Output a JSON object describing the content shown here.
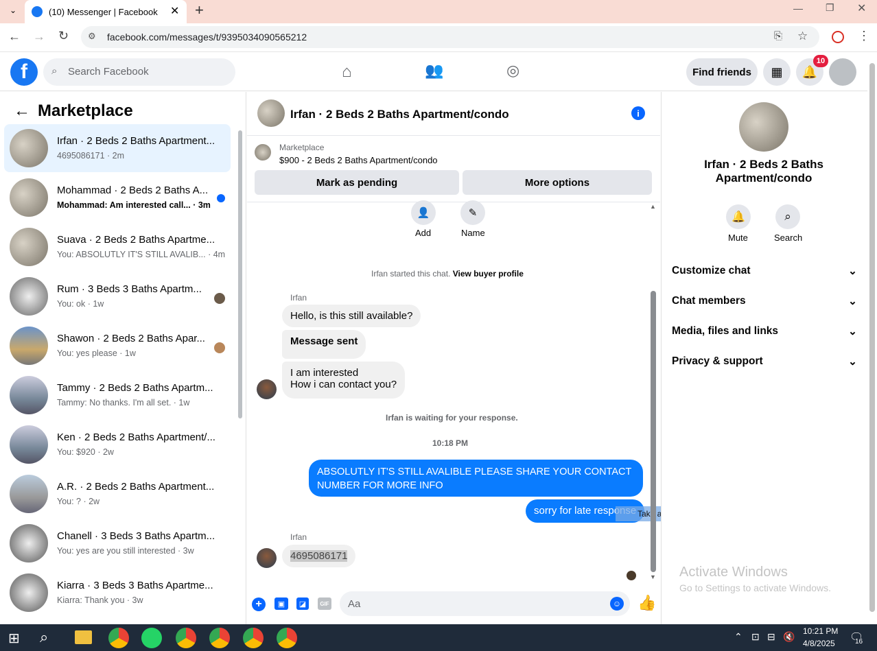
{
  "browser": {
    "tab_title": "(10) Messenger | Facebook",
    "url": "facebook.com/messages/t/9395034090565212"
  },
  "fb": {
    "search_placeholder": "Search Facebook",
    "find_friends": "Find friends",
    "notif_count": "10"
  },
  "left": {
    "title": "Marketplace",
    "conversations": [
      {
        "title": "Irfan · 2 Beds 2 Baths Apartment...",
        "sub": "4695086171 · 2m"
      },
      {
        "title": "Mohammad · 2 Beds 2 Baths A...",
        "sub": "Mohammad: Am interested call... · 3m"
      },
      {
        "title": "Suava · 2 Beds 2 Baths Apartme...",
        "sub": "You: ABSOLUTLY IT'S STILL AVALIB... · 4m"
      },
      {
        "title": "Rum · 3 Beds 3 Baths Apartm...",
        "sub": "You: ok · 1w"
      },
      {
        "title": "Shawon · 2 Beds 2 Baths Apar...",
        "sub": "You: yes please · 1w"
      },
      {
        "title": "Tammy · 2 Beds 2 Baths Apartm...",
        "sub": "Tammy: No thanks. I'm all set. · 1w"
      },
      {
        "title": "Ken · 2 Beds 2 Baths Apartment/...",
        "sub": "You: $920 · 2w"
      },
      {
        "title": "A.R. · 2 Beds 2 Baths Apartment...",
        "sub": "You: ? · 2w"
      },
      {
        "title": "Chanell · 3 Beds 3 Baths Apartm...",
        "sub": "You: yes are you still interested · 3w"
      },
      {
        "title": "Kiarra · 3 Beds 3 Baths Apartme...",
        "sub": "Kiarra: Thank you · 3w"
      }
    ]
  },
  "chat": {
    "header": "Irfan · 2 Beds 2 Baths Apartment/condo",
    "market_label": "Marketplace",
    "listing": "$900 - 2 Beds 2 Baths Apartment/condo",
    "mark_pending": "Mark as pending",
    "more_options": "More options",
    "add": "Add",
    "name": "Name",
    "started": "Irfan started this chat.",
    "view_profile": "View buyer profile",
    "sender": "Irfan",
    "msg1": "Hello, is this still available?",
    "msg2": "Message sent",
    "msg3a": "I am interested",
    "msg3b": "How i can contact you?",
    "waiting": "Irfan is waiting for your response.",
    "time": "10:18 PM",
    "out1": "ABSOLUTLY IT'S STILL AVALIBLE PLEASE SHARE YOUR CONTACT NUMBER  FOR MORE INFO",
    "out2": "sorry for late response",
    "tooltip": "Take a screenshot",
    "sender2": "Irfan",
    "msg4": "4695086171",
    "input_placeholder": "Aa"
  },
  "right": {
    "title": "Irfan · 2 Beds 2 Baths Apartment/condo",
    "mute": "Mute",
    "search": "Search",
    "sections": [
      "Customize chat",
      "Chat members",
      "Media, files and links",
      "Privacy & support"
    ],
    "watermark1": "Activate Windows",
    "watermark2": "Go to Settings to activate Windows."
  },
  "taskbar": {
    "time": "10:21 PM",
    "date": "4/8/2025",
    "notif": "16"
  }
}
